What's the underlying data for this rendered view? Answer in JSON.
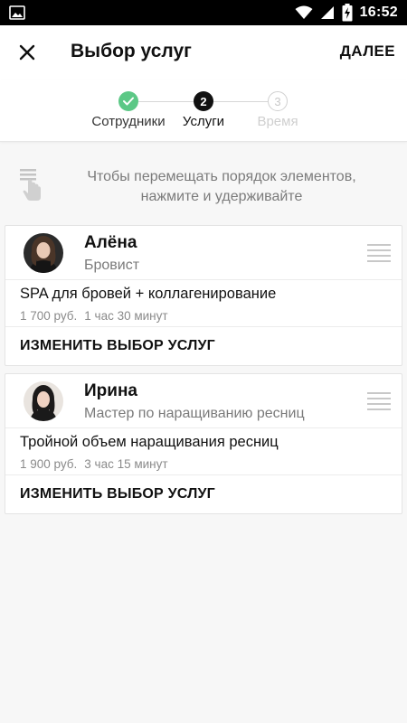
{
  "status_bar": {
    "time": "16:52",
    "icons": [
      "image-icon",
      "wifi-icon",
      "signal-icon",
      "battery-charging-icon"
    ]
  },
  "app_bar": {
    "title": "Выбор услуг",
    "next_label": "ДАЛЕЕ",
    "close_icon": "close-icon"
  },
  "stepper": {
    "steps": [
      {
        "label": "Сотрудники",
        "number": "1",
        "state": "done"
      },
      {
        "label": "Услуги",
        "number": "2",
        "state": "active"
      },
      {
        "label": "Время",
        "number": "3",
        "state": "inactive"
      }
    ],
    "colors": {
      "done": "#5cc886",
      "active": "#111111",
      "inactive": "#d0d0d0"
    }
  },
  "hint": {
    "text": "Чтобы перемещать порядок элементов, нажмите и удерживайте",
    "icon": "touch-drag-icon"
  },
  "cards": [
    {
      "employee": {
        "name": "Алёна",
        "role": "Бровист"
      },
      "service": {
        "name": "SPA для бровей + коллагенирование",
        "price": "1 700 руб.",
        "duration": "1 час 30 минут"
      },
      "change_label": "ИЗМЕНИТЬ ВЫБОР УСЛУГ"
    },
    {
      "employee": {
        "name": "Ирина",
        "role": "Мастер по наращиванию ресниц"
      },
      "service": {
        "name": "Тройной объем наращивания ресниц",
        "price": "1 900 руб.",
        "duration": "3 час 15 минут"
      },
      "change_label": "ИЗМЕНИТЬ ВЫБОР УСЛУГ"
    }
  ]
}
